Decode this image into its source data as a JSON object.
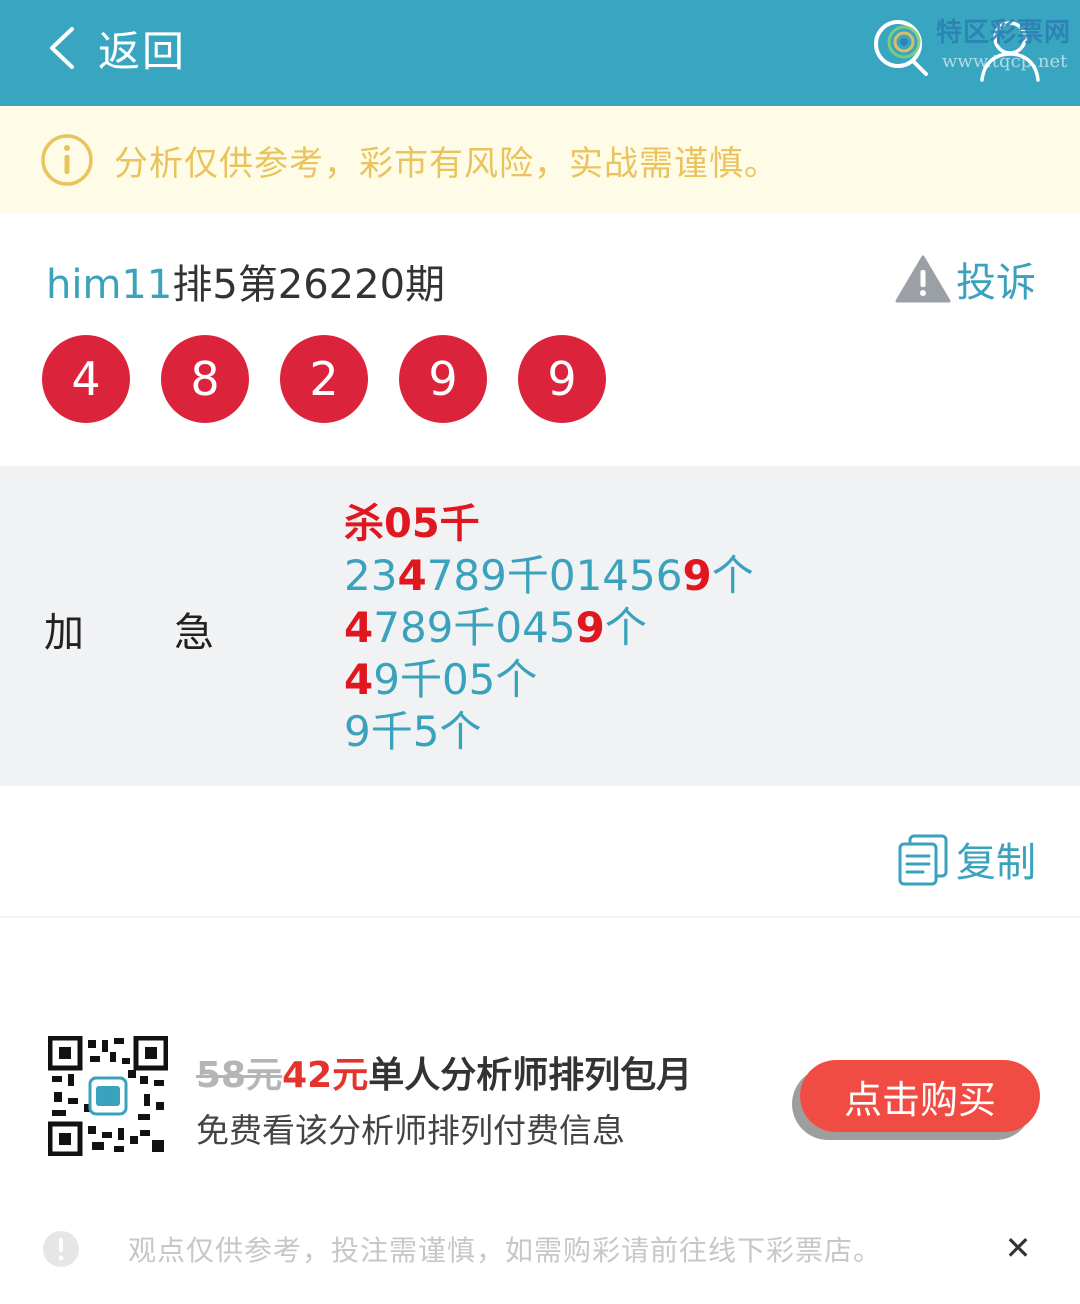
{
  "header": {
    "back_label": "返回",
    "back_icon": "chevron-left-icon",
    "search_icon": "search-icon",
    "user_icon": "user-icon",
    "watermark_title": "特区彩票网",
    "watermark_url": "www.tqcp.net"
  },
  "notice": {
    "icon": "info-icon",
    "text": "分析仅供参考，彩市有风险，实战需谨慎。",
    "color": "#e9c45e"
  },
  "issue": {
    "username": "him11",
    "title": "排5第26220期",
    "complain_label": "投诉",
    "complain_icon": "warning-icon"
  },
  "balls": [
    "4",
    "8",
    "2",
    "9",
    "9"
  ],
  "content": {
    "label_left": "加",
    "label_right": "急",
    "lines": [
      [
        {
          "t": "杀05千",
          "hl": true
        }
      ],
      [
        {
          "t": "23",
          "hl": false
        },
        {
          "t": "4",
          "hl": true
        },
        {
          "t": "789千01456",
          "hl": false
        },
        {
          "t": "9",
          "hl": true
        },
        {
          "t": "个",
          "hl": false
        }
      ],
      [
        {
          "t": "4",
          "hl": true
        },
        {
          "t": "789千045",
          "hl": false
        },
        {
          "t": "9",
          "hl": true
        },
        {
          "t": "个",
          "hl": false
        }
      ],
      [
        {
          "t": "4",
          "hl": true
        },
        {
          "t": "9千05个",
          "hl": false
        }
      ],
      [
        {
          "t": "9千5个",
          "hl": false
        }
      ]
    ]
  },
  "copy": {
    "label": "复制",
    "icon": "copy-icon"
  },
  "promo": {
    "qr_icon": "qr-code-icon",
    "old_price": "58元",
    "new_price": "42元",
    "title": "单人分析师排列包月",
    "subtitle": "免费看该分析师排列付费信息",
    "buy_label": "点击购买"
  },
  "disclaimer": {
    "icon": "alert-circle-icon",
    "text": "观点仅供参考，投注需谨慎，如需购彩请前往线下彩票店。",
    "close_label": "✕"
  },
  "colors": {
    "header_bg": "#38a6c0",
    "accent": "#3aa2bc",
    "ball": "#dc233c",
    "highlight": "#e0171e",
    "buy_button": "#f14c44"
  }
}
